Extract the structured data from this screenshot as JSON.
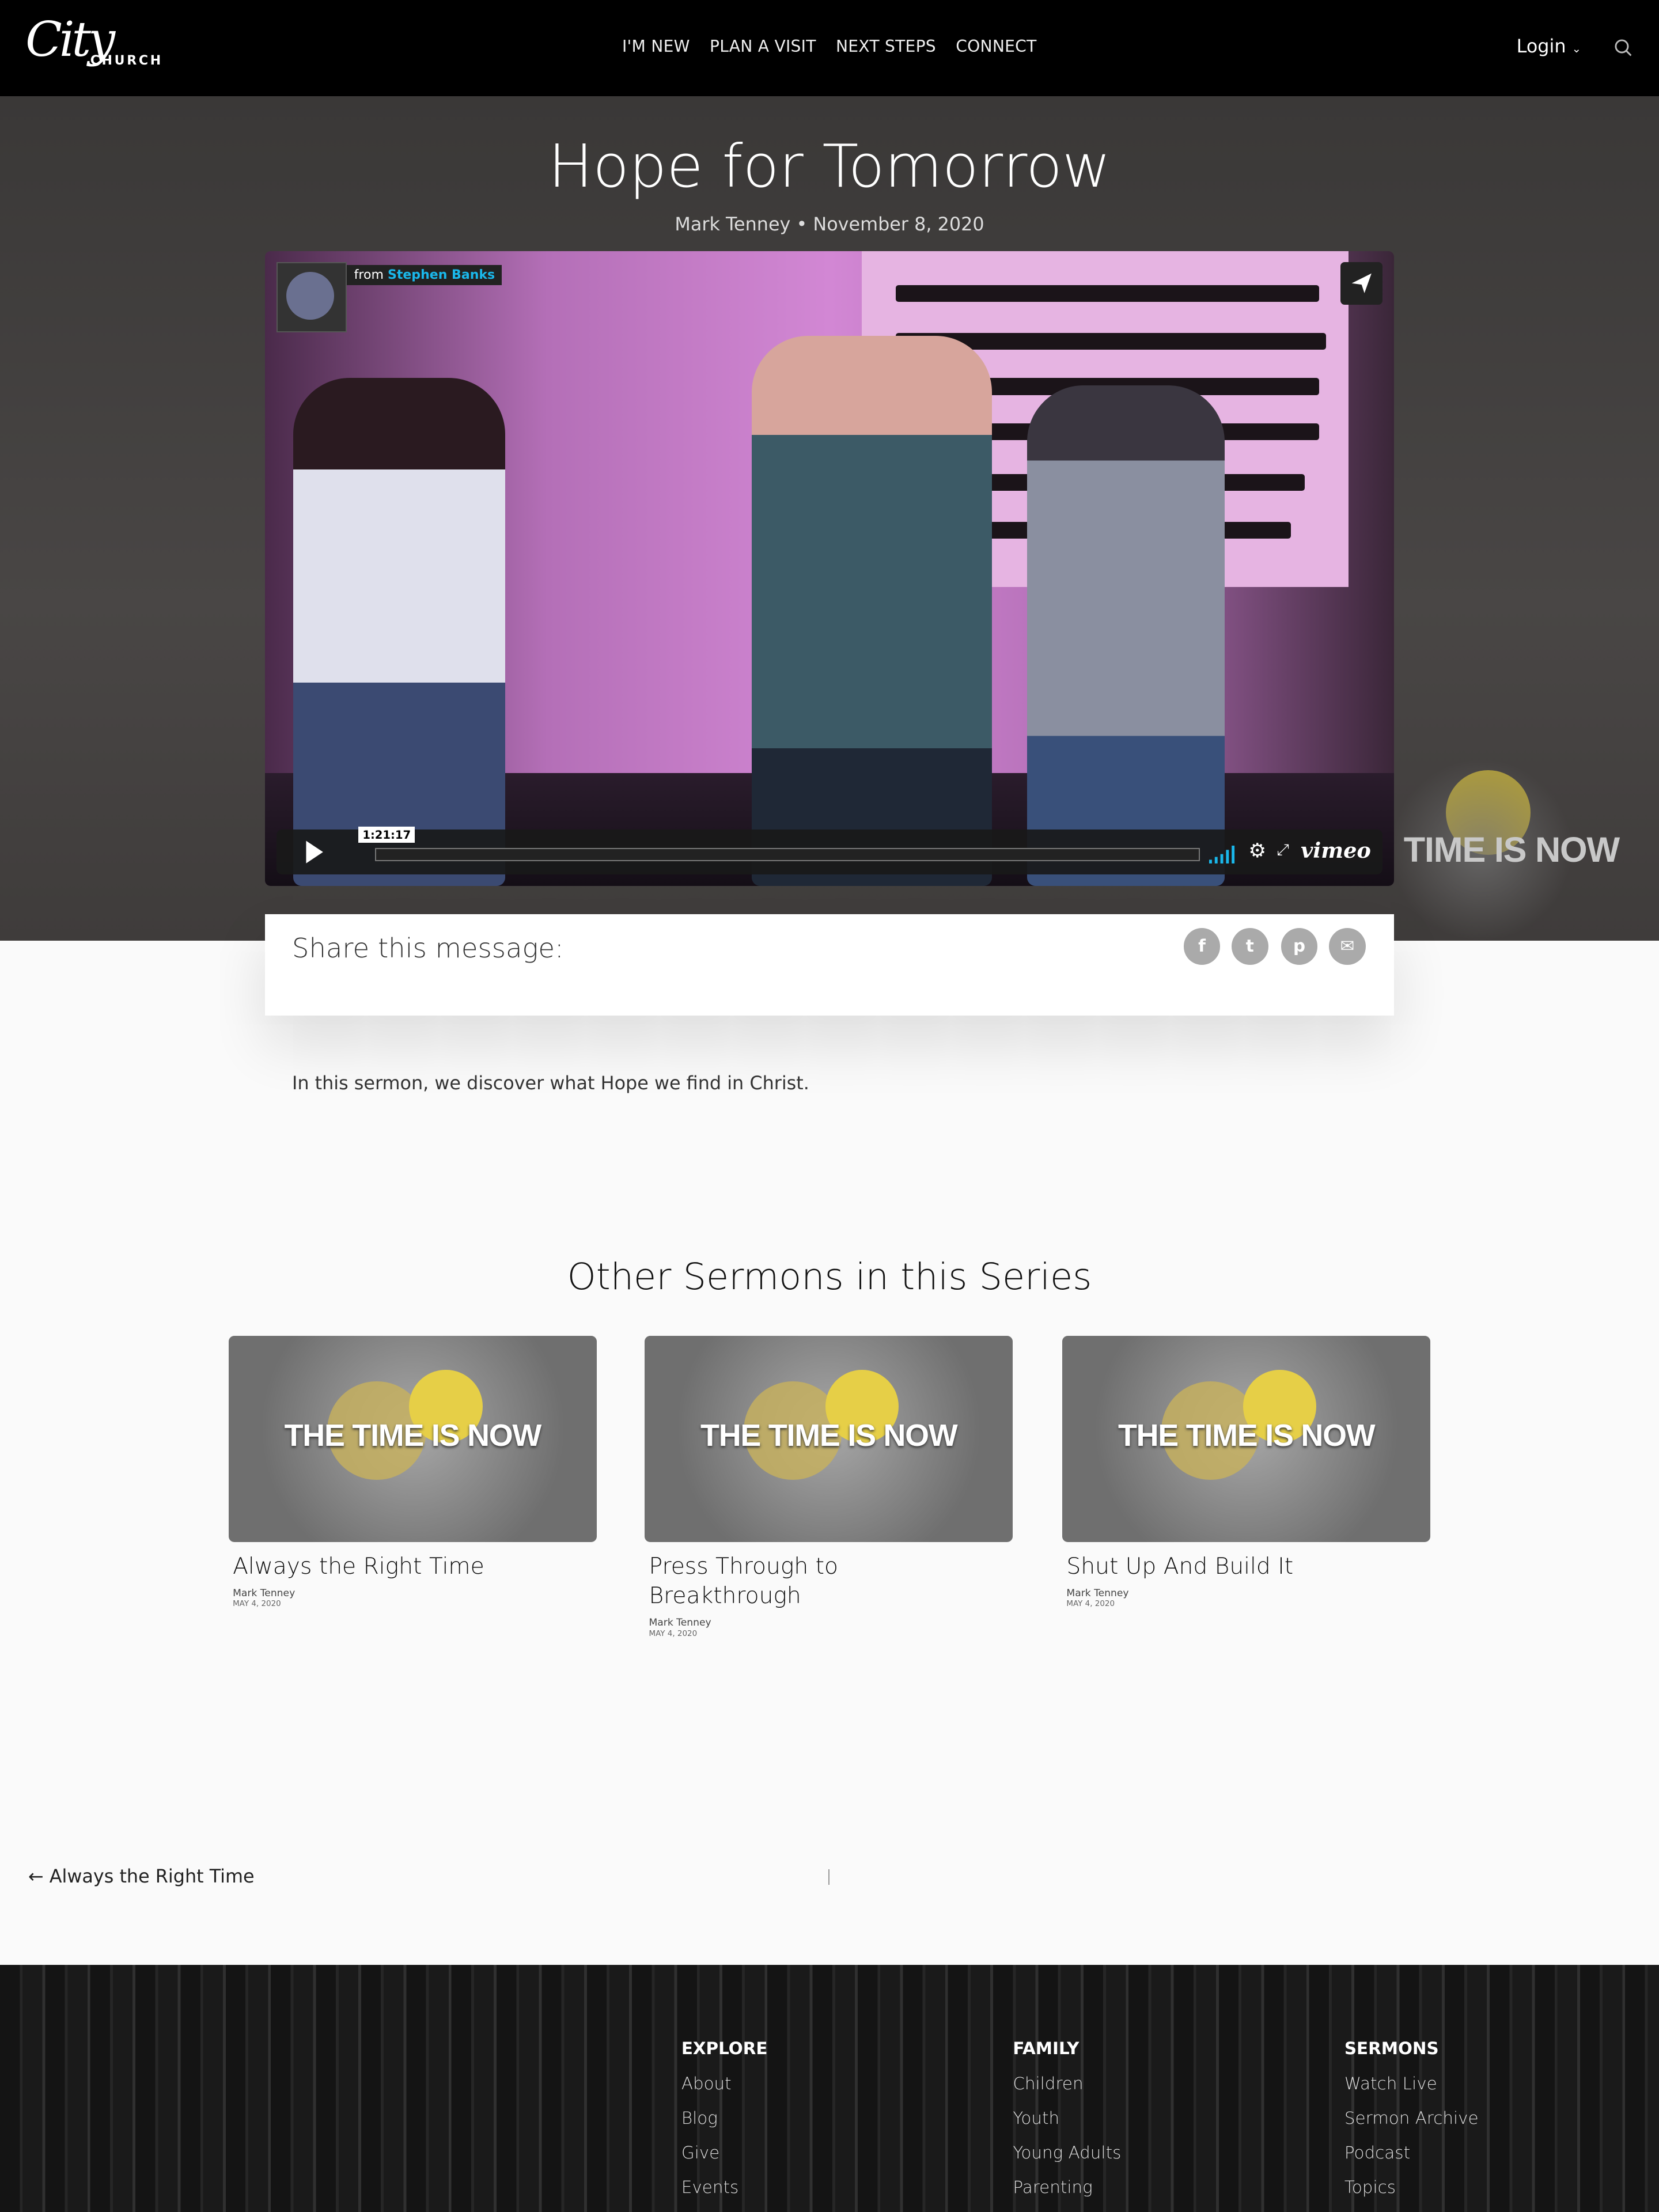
{
  "header": {
    "logo_script": "City",
    "logo_word": "CHURCH",
    "nav": [
      "I'M NEW",
      "PLAN A VISIT",
      "NEXT STEPS",
      "CONNECT"
    ],
    "login_label": "Login",
    "search_icon": "search-icon"
  },
  "hero": {
    "title": "Hope for Tomorrow",
    "subtitle": "Mark Tenney • November 8, 2020",
    "series_art_text": "TIME IS NOW"
  },
  "video": {
    "from_label": "from",
    "from_name": "Stephen Banks",
    "duration": "1:21:17",
    "brand": "vimeo",
    "progress_percent": 0,
    "accent": "#1ab7ea"
  },
  "share": {
    "label": "Share this message:",
    "icons": [
      "facebook-icon",
      "twitter-icon",
      "pinterest-icon",
      "email-icon"
    ]
  },
  "description": "In this sermon, we discover what Hope we find in Christ.",
  "series": {
    "heading": "Other Sermons in this Series",
    "thumb_text": "THE TIME IS NOW",
    "cards": [
      {
        "title": "Always the Right Time",
        "author": "Mark Tenney",
        "date": "MAY 4, 2020"
      },
      {
        "title": "Press Through to Breakthrough",
        "author": "Mark Tenney",
        "date": "MAY 4, 2020"
      },
      {
        "title": "Shut Up And Build It",
        "author": "Mark Tenney",
        "date": "MAY 4, 2020"
      }
    ]
  },
  "pagination": {
    "prev_label": "← Always the Right Time"
  },
  "footer": {
    "columns": [
      {
        "heading": "EXPLORE",
        "links": [
          "About",
          "Blog",
          "Give",
          "Events"
        ]
      },
      {
        "heading": "FAMILY",
        "links": [
          "Children",
          "Youth",
          "Young Adults",
          "Parenting"
        ]
      },
      {
        "heading": "SERMONS",
        "links": [
          "Watch Live",
          "Sermon Archive",
          "Podcast",
          "Topics"
        ]
      }
    ]
  }
}
